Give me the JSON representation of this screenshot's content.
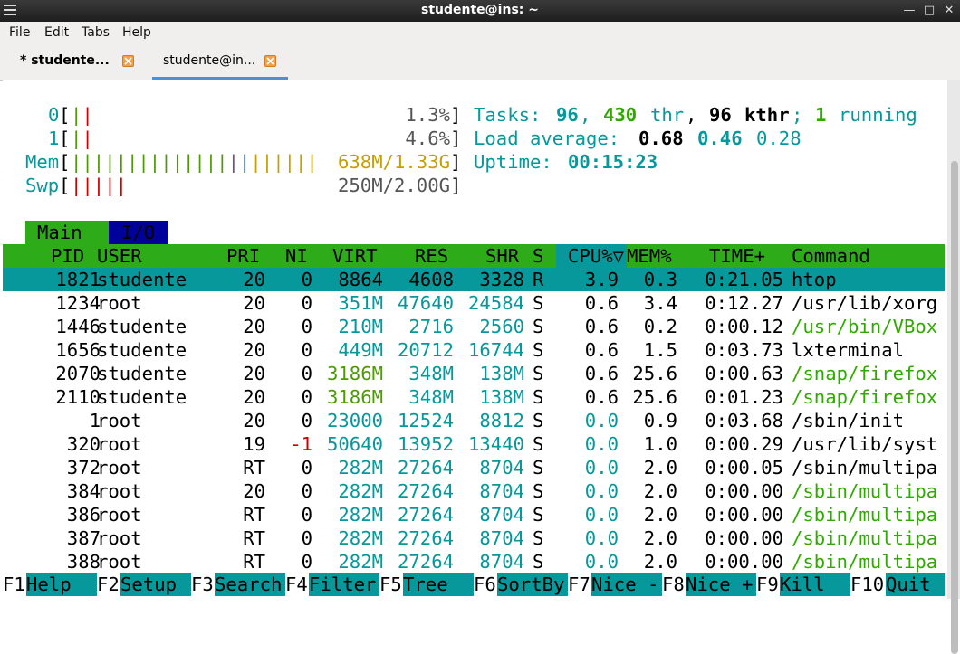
{
  "window": {
    "title": "studente@ins: ~"
  },
  "menu": [
    "File",
    "Edit",
    "Tabs",
    "Help"
  ],
  "tabs": [
    {
      "label": "* studente..."
    },
    {
      "label": "studente@in..."
    }
  ],
  "meters": {
    "cpu0": {
      "label": "0",
      "value": "1.3%"
    },
    "cpu1": {
      "label": "1",
      "value": "4.6%"
    },
    "mem": {
      "label": "Mem",
      "value": "638M/1.33G"
    },
    "swp": {
      "label": "Swp",
      "value": "250M/2.00G"
    }
  },
  "info": {
    "tasks_label": "Tasks:",
    "tasks": "96",
    "thr": "430",
    "thr_label": "thr",
    "kthr": "96",
    "kthr_label": "kthr",
    "running": "1",
    "running_label": "running",
    "load_label": "Load average:",
    "load1": "0.68",
    "load5": "0.46",
    "load15": "0.28",
    "uptime_label": "Uptime:",
    "uptime": "00:15:23"
  },
  "screen_tabs": {
    "main": "Main",
    "io": "I/O"
  },
  "columns": [
    "PID",
    "USER",
    "PRI",
    "NI",
    "VIRT",
    "RES",
    "SHR",
    "S",
    "CPU%▽",
    "MEM%",
    "TIME+",
    "Command"
  ],
  "processes": [
    {
      "pid": "1821",
      "user": "studente",
      "pri": "20",
      "ni": "0",
      "virt": "8864",
      "res": "4608",
      "shr": "3328",
      "s": "R",
      "cpu": "3.9",
      "mem": "0.3",
      "time": "0:21.05",
      "cmd": "htop"
    },
    {
      "pid": "1234",
      "user": "root",
      "pri": "20",
      "ni": "0",
      "virt": "351M",
      "res": "47640",
      "shr": "24584",
      "s": "S",
      "cpu": "0.6",
      "mem": "3.4",
      "time": "0:12.27",
      "cmd": "/usr/lib/xorg"
    },
    {
      "pid": "1446",
      "user": "studente",
      "pri": "20",
      "ni": "0",
      "virt": "210M",
      "res": "2716",
      "shr": "2560",
      "s": "S",
      "cpu": "0.6",
      "mem": "0.2",
      "time": "0:00.12",
      "cmd": "/usr/bin/VBox"
    },
    {
      "pid": "1656",
      "user": "studente",
      "pri": "20",
      "ni": "0",
      "virt": "449M",
      "res": "20712",
      "shr": "16744",
      "s": "S",
      "cpu": "0.6",
      "mem": "1.5",
      "time": "0:03.73",
      "cmd": "lxterminal"
    },
    {
      "pid": "2070",
      "user": "studente",
      "pri": "20",
      "ni": "0",
      "virt": "3186M",
      "res": "348M",
      "shr": "138M",
      "s": "S",
      "cpu": "0.6",
      "mem": "25.6",
      "time": "0:00.63",
      "cmd": "/snap/firefox"
    },
    {
      "pid": "2110",
      "user": "studente",
      "pri": "20",
      "ni": "0",
      "virt": "3186M",
      "res": "348M",
      "shr": "138M",
      "s": "S",
      "cpu": "0.6",
      "mem": "25.6",
      "time": "0:01.23",
      "cmd": "/snap/firefox"
    },
    {
      "pid": "1",
      "user": "root",
      "pri": "20",
      "ni": "0",
      "virt": "23000",
      "res": "12524",
      "shr": "8812",
      "s": "S",
      "cpu": "0.0",
      "mem": "0.9",
      "time": "0:03.68",
      "cmd": "/sbin/init"
    },
    {
      "pid": "320",
      "user": "root",
      "pri": "19",
      "ni": "-1",
      "virt": "50640",
      "res": "13952",
      "shr": "13440",
      "s": "S",
      "cpu": "0.0",
      "mem": "1.0",
      "time": "0:00.29",
      "cmd": "/usr/lib/syst"
    },
    {
      "pid": "372",
      "user": "root",
      "pri": "RT",
      "ni": "0",
      "virt": "282M",
      "res": "27264",
      "shr": "8704",
      "s": "S",
      "cpu": "0.0",
      "mem": "2.0",
      "time": "0:00.05",
      "cmd": "/sbin/multipa"
    },
    {
      "pid": "384",
      "user": "root",
      "pri": "20",
      "ni": "0",
      "virt": "282M",
      "res": "27264",
      "shr": "8704",
      "s": "S",
      "cpu": "0.0",
      "mem": "2.0",
      "time": "0:00.00",
      "cmd": "/sbin/multipa"
    },
    {
      "pid": "386",
      "user": "root",
      "pri": "RT",
      "ni": "0",
      "virt": "282M",
      "res": "27264",
      "shr": "8704",
      "s": "S",
      "cpu": "0.0",
      "mem": "2.0",
      "time": "0:00.00",
      "cmd": "/sbin/multipa"
    },
    {
      "pid": "387",
      "user": "root",
      "pri": "RT",
      "ni": "0",
      "virt": "282M",
      "res": "27264",
      "shr": "8704",
      "s": "S",
      "cpu": "0.0",
      "mem": "2.0",
      "time": "0:00.00",
      "cmd": "/sbin/multipa"
    },
    {
      "pid": "388",
      "user": "root",
      "pri": "RT",
      "ni": "0",
      "virt": "282M",
      "res": "27264",
      "shr": "8704",
      "s": "S",
      "cpu": "0.0",
      "mem": "2.0",
      "time": "0:00.00",
      "cmd": "/sbin/multipa"
    }
  ],
  "function_keys": [
    {
      "key": "F1",
      "label": "Help"
    },
    {
      "key": "F2",
      "label": "Setup"
    },
    {
      "key": "F3",
      "label": "Search"
    },
    {
      "key": "F4",
      "label": "Filter"
    },
    {
      "key": "F5",
      "label": "Tree"
    },
    {
      "key": "F6",
      "label": "SortBy"
    },
    {
      "key": "F7",
      "label": "Nice -"
    },
    {
      "key": "F8",
      "label": "Nice +"
    },
    {
      "key": "F9",
      "label": "Kill"
    },
    {
      "key": "F10",
      "label": "Quit"
    }
  ]
}
